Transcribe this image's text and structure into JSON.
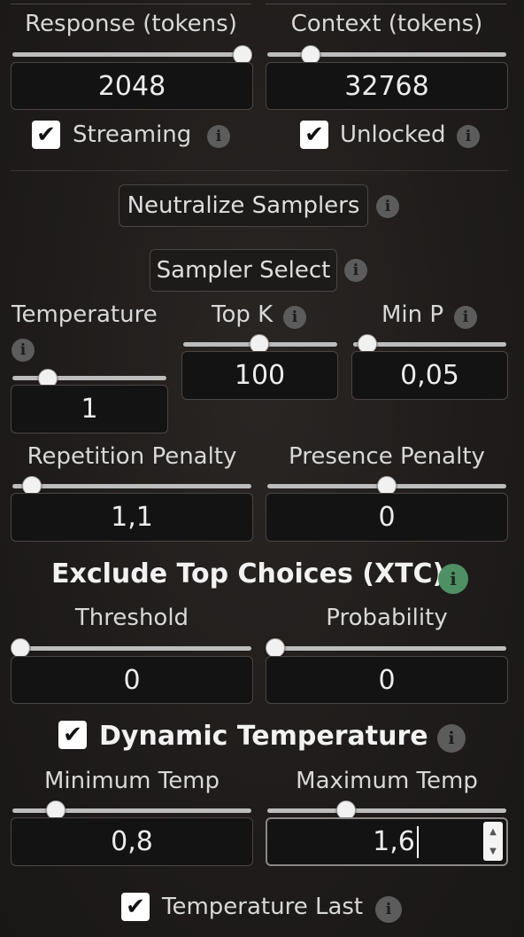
{
  "response": {
    "label": "Response (tokens)",
    "value": "2048",
    "fraction": 0.97
  },
  "context": {
    "label": "Context (tokens)",
    "value": "32768",
    "fraction": 0.18
  },
  "streaming": {
    "label": "Streaming",
    "checked": true
  },
  "unlocked": {
    "label": "Unlocked",
    "checked": true
  },
  "neutralize_button": "Neutralize Samplers",
  "sampler_select_button": "Sampler Select",
  "temperature": {
    "label": "Temperature",
    "value": "1",
    "fraction": 0.24
  },
  "top_k": {
    "label": "Top K",
    "value": "100",
    "fraction": 0.5
  },
  "min_p": {
    "label": "Min P",
    "value": "0,05",
    "fraction": 0.05
  },
  "repetition_penalty": {
    "label": "Repetition Penalty",
    "value": "1,1",
    "fraction": 0.07
  },
  "presence_penalty": {
    "label": "Presence Penalty",
    "value": "0",
    "fraction": 0.5
  },
  "xtc": {
    "heading": "Exclude Top Choices (XTC)",
    "threshold": {
      "label": "Threshold",
      "value": "0",
      "fraction": 0.0
    },
    "probability": {
      "label": "Probability",
      "value": "0",
      "fraction": 0.0
    }
  },
  "dynamic_temperature": {
    "heading": "Dynamic Temperature",
    "checked": true,
    "min": {
      "label": "Minimum Temp",
      "value": "0,8",
      "fraction": 0.15
    },
    "max": {
      "label": "Maximum Temp",
      "value": "1,6",
      "fraction": 0.33
    }
  },
  "temperature_last": {
    "label": "Temperature Last",
    "checked": true
  },
  "icons": {
    "info": "info-icon",
    "check": "checkmark-icon",
    "spinner": "spinner-arrows-icon"
  },
  "colors": {
    "background": "#1f1c1b",
    "field": "#141313",
    "info_green": "#4f8f64"
  }
}
